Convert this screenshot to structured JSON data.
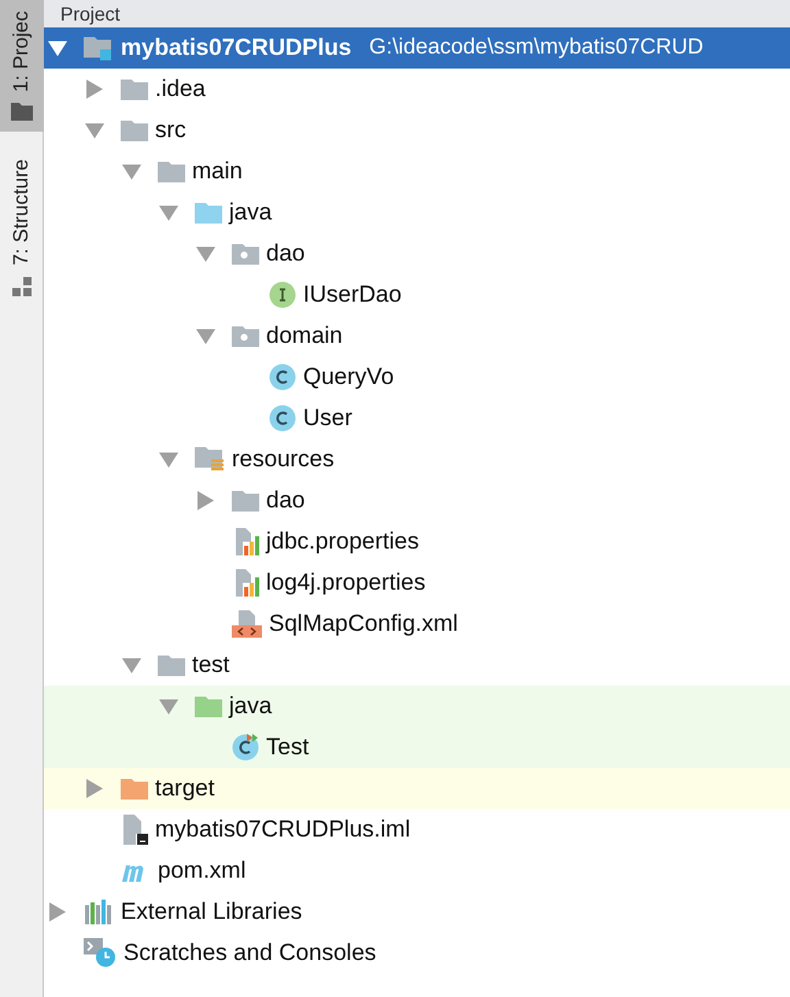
{
  "side_tabs": [
    {
      "label": "1: Projec",
      "selected": true,
      "kind": "project"
    },
    {
      "label": "7: Structure",
      "selected": false,
      "kind": "structure"
    }
  ],
  "header": {
    "title": "Project"
  },
  "tree": [
    {
      "name": "mybatis07CRUDPlus",
      "path": "G:\\ideacode\\ssm\\mybatis07CRUD",
      "kind": "module",
      "expanded": true,
      "selected": true,
      "children": [
        {
          "name": ".idea",
          "kind": "folder",
          "expanded": false,
          "selected": false
        },
        {
          "name": "src",
          "kind": "folder",
          "expanded": true,
          "selected": false,
          "children": [
            {
              "name": "main",
              "kind": "folder",
              "expanded": true,
              "selected": false,
              "children": [
                {
                  "name": "java",
                  "kind": "source-folder",
                  "expanded": true,
                  "selected": false,
                  "children": [
                    {
                      "name": "dao",
                      "kind": "package",
                      "expanded": true,
                      "selected": false,
                      "children": [
                        {
                          "name": "IUserDao",
                          "kind": "interface",
                          "selected": false
                        }
                      ]
                    },
                    {
                      "name": "domain",
                      "kind": "package",
                      "expanded": true,
                      "selected": false,
                      "children": [
                        {
                          "name": "QueryVo",
                          "kind": "class",
                          "selected": false
                        },
                        {
                          "name": "User",
                          "kind": "class",
                          "selected": false
                        }
                      ]
                    }
                  ]
                },
                {
                  "name": "resources",
                  "kind": "resources-folder",
                  "expanded": true,
                  "selected": false,
                  "children": [
                    {
                      "name": "dao",
                      "kind": "folder",
                      "expanded": false,
                      "selected": false
                    },
                    {
                      "name": "jdbc.properties",
                      "kind": "properties",
                      "selected": false
                    },
                    {
                      "name": "log4j.properties",
                      "kind": "properties",
                      "selected": false
                    },
                    {
                      "name": "SqlMapConfig.xml",
                      "kind": "xml",
                      "selected": false
                    }
                  ]
                }
              ]
            },
            {
              "name": "test",
              "kind": "folder",
              "expanded": true,
              "selected": false,
              "children": [
                {
                  "name": "java",
                  "kind": "test-folder",
                  "color": "#effaea",
                  "expanded": true,
                  "selected": false,
                  "children": [
                    {
                      "name": "Test",
                      "kind": "test-class",
                      "color": "#effaea",
                      "selected": false
                    }
                  ]
                }
              ]
            }
          ]
        },
        {
          "name": "target",
          "kind": "excluded-folder",
          "color": "#fefee6",
          "expanded": false,
          "selected": false
        },
        {
          "name": "mybatis07CRUDPlus.iml",
          "kind": "iml",
          "selected": false
        },
        {
          "name": "pom.xml",
          "kind": "maven",
          "selected": false
        }
      ]
    },
    {
      "name": "External Libraries",
      "kind": "libraries",
      "expanded": false,
      "selected": false
    },
    {
      "name": "Scratches and Consoles",
      "kind": "scratches",
      "selected": false
    }
  ]
}
